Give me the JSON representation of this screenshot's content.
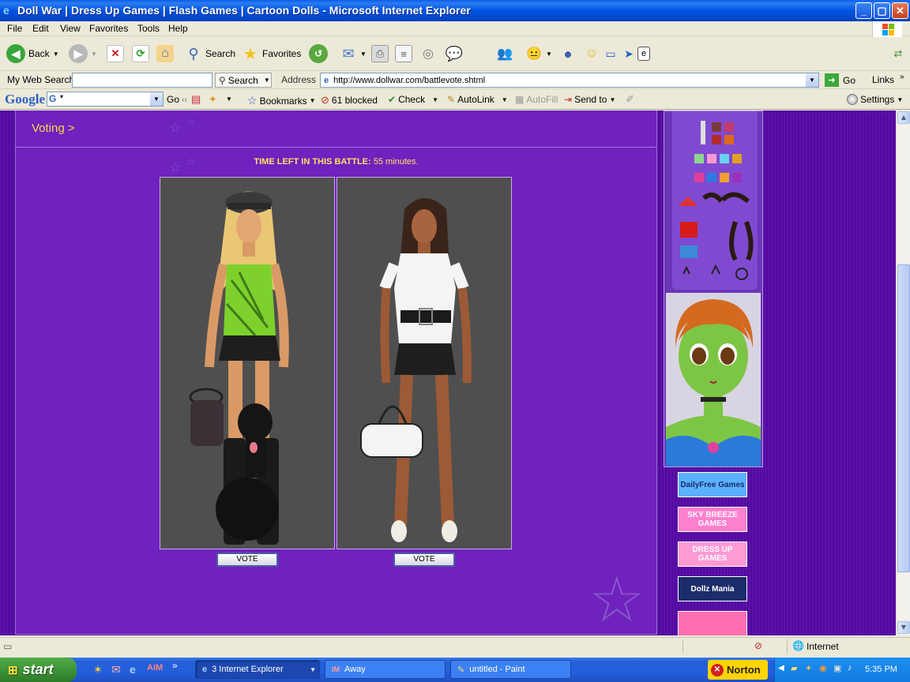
{
  "window": {
    "title": "Doll War | Dress Up Games | Flash Games | Cartoon Dolls - Microsoft Internet Explorer",
    "buttons": {
      "minimize": "_",
      "maximize": "▢",
      "close": "✕"
    }
  },
  "menu": [
    "File",
    "Edit",
    "View",
    "Favorites",
    "Tools",
    "Help"
  ],
  "toolbar": {
    "back_label": "Back",
    "search_label": "Search",
    "favorites_label": "Favorites"
  },
  "addressbar": {
    "my_web_search_label": "My Web Search",
    "my_web_search_value": "",
    "search_button_label": "Search",
    "address_label": "Address",
    "url": "http://www.dollwar.com/battlevote.shtml",
    "go_label": "Go",
    "links_label": "Links"
  },
  "googlebar": {
    "logo": "Google",
    "go_label": "Go",
    "bookmarks_label": "Bookmarks",
    "blocked_label": "61 blocked",
    "check_label": "Check",
    "autolink_label": "AutoLink",
    "autofill_label": "AutoFill",
    "sendto_label": "Send to",
    "settings_label": "Settings"
  },
  "page": {
    "voting_title": "Voting >",
    "time_left_label": "TIME LEFT IN THIS BATTLE:",
    "time_left_value": " 55 minutes.",
    "vote_left_label": "VOTE",
    "vote_right_label": "VOTE"
  },
  "side_banners": [
    {
      "label": "DailyFree Games",
      "bg": "#5bb0ff",
      "color": "#1a2c66"
    },
    {
      "label": "SKY BREEZE GAMES",
      "bg": "#ff7fd0",
      "color": "#ffffff"
    },
    {
      "label": "DRESS UP GAMES",
      "bg": "#ff9ad5",
      "color": "#ffffff"
    },
    {
      "label": "Dollz Mania",
      "bg": "#1b2d6a",
      "color": "#ffffff"
    },
    {
      "label": "",
      "bg": "#ff6fb1",
      "color": "#ffffff"
    }
  ],
  "statusbar": {
    "zone_label": "Internet"
  },
  "taskbar": {
    "start_label": "start",
    "tasks": [
      "3 Internet Explorer",
      "Away",
      "untitled - Paint"
    ],
    "norton_label": "Norton",
    "clock": "5:35 PM"
  },
  "colors": {
    "page_bg": "#5a0fa6",
    "panel_bg": "#6f22bd",
    "title_accent": "#ffd84a"
  }
}
